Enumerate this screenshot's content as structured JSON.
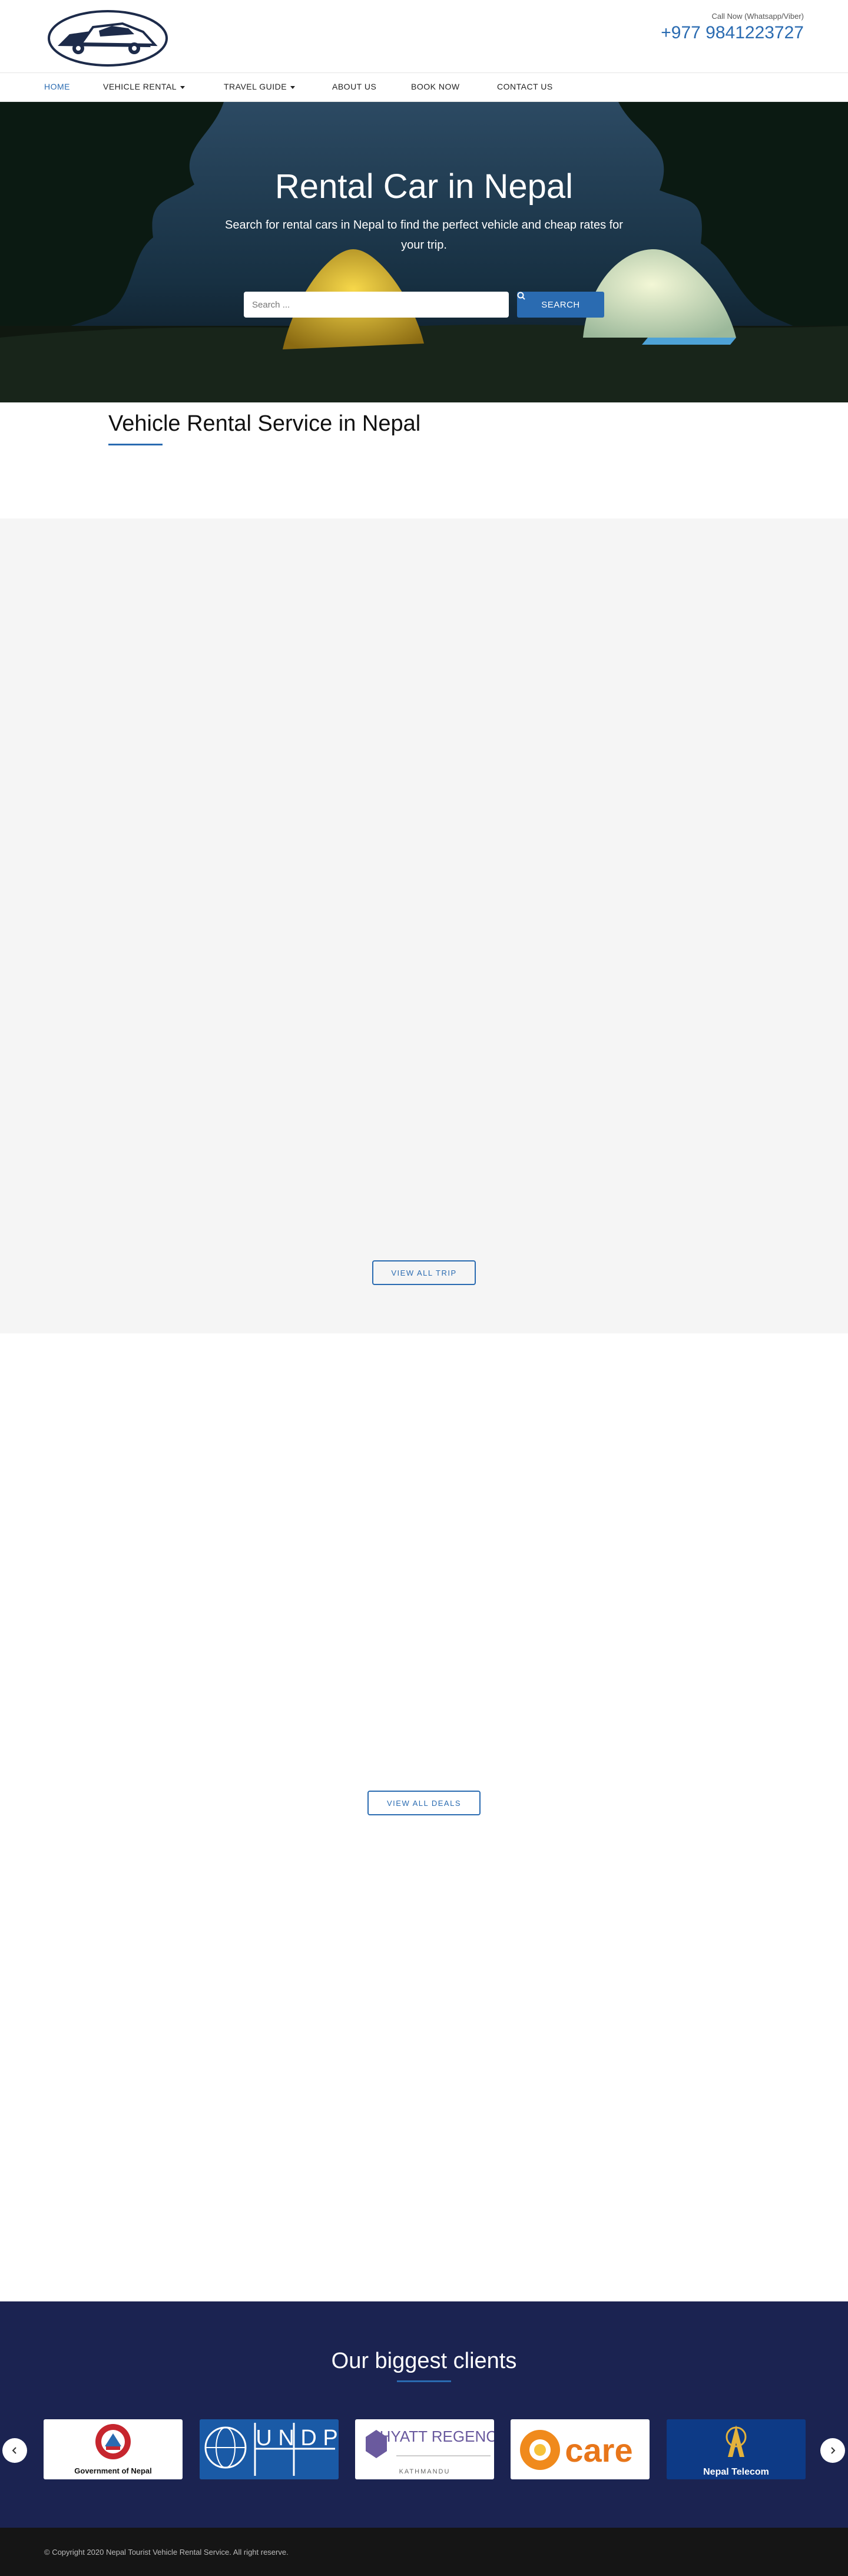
{
  "header": {
    "call_label": "Call Now (Whatsapp/Viber)",
    "phone": "+977 9841223727"
  },
  "nav": {
    "items": [
      {
        "label": "HOME",
        "active": true
      },
      {
        "label": "VEHICLE RENTAL",
        "dropdown": true
      },
      {
        "label": "TRAVEL GUIDE",
        "dropdown": true
      },
      {
        "label": "ABOUT US"
      },
      {
        "label": "BOOK NOW"
      },
      {
        "label": "CONTACT US"
      }
    ]
  },
  "hero": {
    "title": "Rental Car in Nepal",
    "subtitle": "Search for rental cars in Nepal to find the perfect vehicle and cheap rates for your trip.",
    "search_placeholder": "Search ...",
    "search_button": "SEARCH"
  },
  "section": {
    "title": "Vehicle Rental Service in Nepal"
  },
  "buttons": {
    "view_all_trip": "VIEW ALL TRIP",
    "view_all_deals": "VIEW ALL DEALS"
  },
  "clients": {
    "title": "Our biggest clients",
    "logos": [
      {
        "name": "Government of Nepal",
        "text": "Government of Nepal"
      },
      {
        "name": "UNDP",
        "text": "U N D P"
      },
      {
        "name": "Hyatt Regency",
        "text": "HYATT REGENCY",
        "sub": "KATHMANDU"
      },
      {
        "name": "CARE",
        "text": "care"
      },
      {
        "name": "Nepal Telecom",
        "text": "Nepal Telecom"
      }
    ]
  },
  "footer": {
    "copyright": "© Copyright 2020 Nepal Tourist Vehicle Rental Service. All right reserve."
  },
  "colors": {
    "accent": "#2a6bb1",
    "clients_bg": "#1b2351",
    "footer_bg": "#151515",
    "grey_section": "#f5f5f5"
  }
}
